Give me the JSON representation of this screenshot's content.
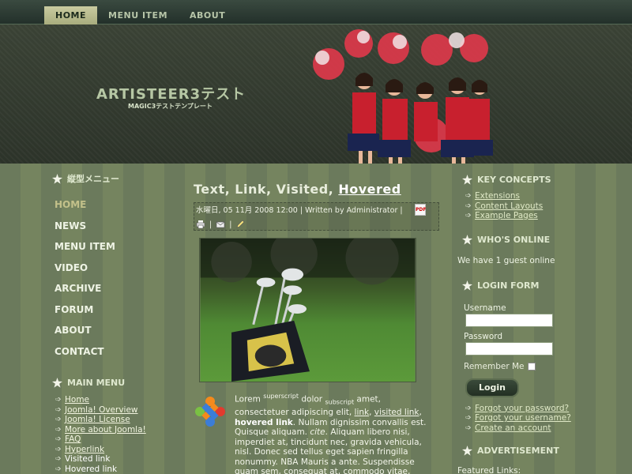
{
  "topnav": {
    "items": [
      "HOME",
      "MENU ITEM",
      "ABOUT"
    ]
  },
  "header": {
    "title": "ARTISTEER3テスト",
    "slogan": "MAGIC3テストテンプレート"
  },
  "left": {
    "vmenu_title": "縦型メニュー",
    "vmenu": [
      "HOME",
      "NEWS",
      "MENU ITEM",
      "VIDEO",
      "ARCHIVE",
      "FORUM",
      "ABOUT",
      "CONTACT"
    ],
    "mainmenu_title": "MAIN MENU",
    "mainmenu": [
      "Home",
      "Joomla! Overview",
      "Joomla! License",
      "More about Joomla!",
      "FAQ",
      "Hyperlink",
      "Visited link",
      "Hovered link"
    ]
  },
  "article": {
    "title_a": "Text, Link, Visited, ",
    "title_b": "Hovered",
    "meta": "水曜日, 05 11月 2008 12:00 | Written by Administrator |",
    "pdf_label": "PDF",
    "p_lorem": "Lorem ",
    "p_sup": "superscript",
    "p_dolor": " dolor ",
    "p_sub": "subscript",
    "p_amet": " amet, consectetuer adipiscing elit, ",
    "p_link": "link",
    "p_comma1": ", ",
    "p_visited": "visited link",
    "p_comma2": ", ",
    "p_hovered": "hovered link",
    "p_rest1": ". Nullam dignissim convallis est. Quisque aliquam. ",
    "p_cite": "cite",
    "p_rest2": ". Aliquam libero nisi, imperdiet at, tincidunt nec, gravida vehicula, nisl. Donec sed tellus eget sapien fringilla nonummy. NBA Mauris a ante. Suspendisse quam sem, consequat at, commodo vitae, feugiat in, nunc. AVE"
  },
  "right": {
    "concepts_title": "KEY CONCEPTS",
    "concepts": [
      "Extensions",
      "Content Layouts",
      "Example Pages"
    ],
    "online_title": "WHO'S ONLINE",
    "online_text": "We have 1 guest online",
    "login_title": "LOGIN FORM",
    "username_label": "Username",
    "password_label": "Password",
    "remember_label": "Remember Me",
    "login_button": "Login",
    "login_links": [
      "Forgot your password?",
      "Forgot your username?",
      "Create an account"
    ],
    "adv_title": "ADVERTISEMENT",
    "adv_text": "Featured Links:"
  },
  "colors": {
    "accent": "#c3c18a",
    "stripe_dark": "#6b7a5c",
    "stripe_light": "#75845f"
  }
}
